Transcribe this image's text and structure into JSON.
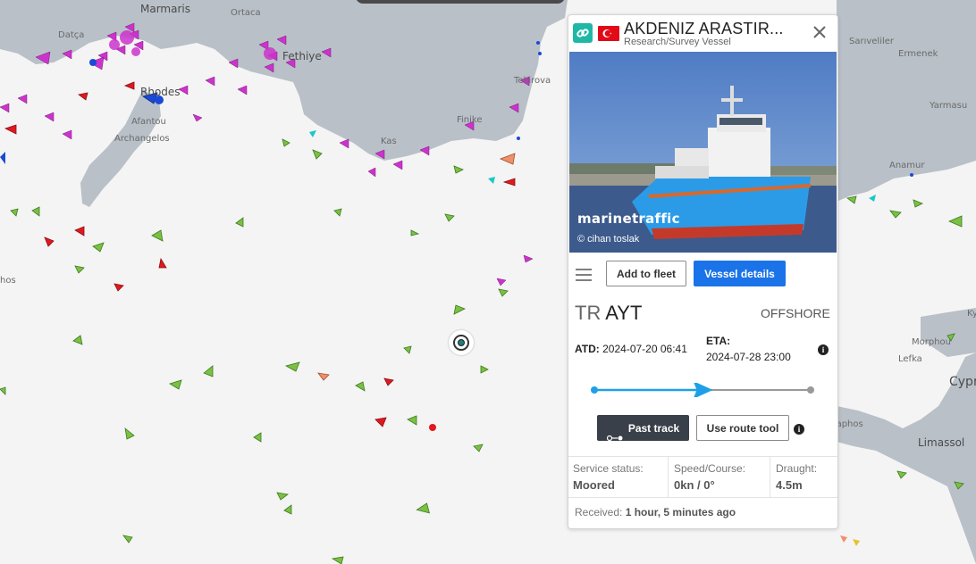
{
  "map": {
    "places": [
      {
        "name": "Marmaris",
        "big": true
      },
      {
        "name": "Ortaca"
      },
      {
        "name": "Datça"
      },
      {
        "name": "Fethiye",
        "big": true
      },
      {
        "name": "Rhodes",
        "big": true
      },
      {
        "name": "Afantou"
      },
      {
        "name": "Archangelos"
      },
      {
        "name": "Finike"
      },
      {
        "name": "Kas"
      },
      {
        "name": "Tekirova"
      },
      {
        "name": "Sarıveliler"
      },
      {
        "name": "Ermenek"
      },
      {
        "name": "Yarmasu"
      },
      {
        "name": "Anamur"
      },
      {
        "name": "Morphou"
      },
      {
        "name": "Lefka"
      },
      {
        "name": "Cyprus",
        "big": true
      },
      {
        "name": "Paphos"
      },
      {
        "name": "Limassol",
        "big": true
      },
      {
        "name": "Ky"
      },
      {
        "name": "hos"
      }
    ],
    "colors": {
      "sea": "#f4f4f4",
      "land": "#b9c0c8",
      "cargo": "#7ac143",
      "tanker": "#e0191f",
      "passenger": "#1a4ad6",
      "pleasure": "#cc33cc",
      "fishing": "#f0906a",
      "tug": "#19c8c8"
    }
  },
  "panel": {
    "vessel_name": "AKDENIZ ARASTIR...",
    "vessel_type": "Research/Survey Vessel",
    "flag": "Turkey",
    "photo_logo": "marinetraffic",
    "photo_credit": "© cihan toslak",
    "buttons": {
      "add_to_fleet": "Add to fleet",
      "vessel_details": "Vessel details",
      "past_track": "Past track",
      "use_route_tool": "Use route tool"
    },
    "port": {
      "country": "TR",
      "code": "AYT"
    },
    "port_status": "OFFSHORE",
    "atd": {
      "label": "ATD:",
      "value": "2024-07-20 06:41"
    },
    "eta": {
      "label": "ETA:",
      "value": "2024-07-28 23:00"
    },
    "progress": 0.49,
    "stats": {
      "service_status": {
        "label": "Service status:",
        "value": "Moored"
      },
      "speed_course": {
        "label": "Speed/Course:",
        "value": "0kn / 0°"
      },
      "draught": {
        "label": "Draught:",
        "value": "4.5m"
      }
    },
    "received": {
      "label": "Received:",
      "value": "1 hour, 5 minutes ago"
    }
  }
}
